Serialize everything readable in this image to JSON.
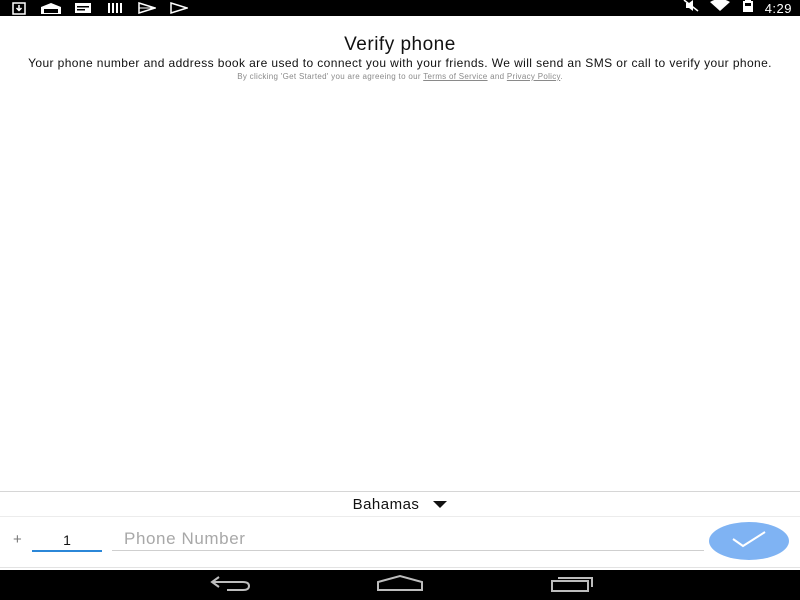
{
  "status_bar": {
    "left_icons": [
      "download-icon",
      "photo-icon",
      "message-icon",
      "barcode-icon",
      "play-store-icon",
      "play-store-icon-2"
    ],
    "right_icons": [
      "mute-icon",
      "wifi-icon",
      "battery-icon"
    ],
    "time": "4:29"
  },
  "header": {
    "title": "Verify phone",
    "description": "Your phone number and address book are used to connect you with your friends. We will send an SMS or call to verify your phone.",
    "terms_prefix": "By clicking 'Get Started' you are agreeing to our ",
    "terms_link": "Terms of Service",
    "terms_and": " and ",
    "privacy_link": "Privacy Policy",
    "terms_suffix": "."
  },
  "form": {
    "country": "Bahamas",
    "plus": "+",
    "country_code": "1",
    "phone_placeholder": "Phone Number",
    "phone_value": ""
  },
  "colors": {
    "accent": "#2b87d8",
    "submit_button": "#7fb3f3"
  },
  "nav_bar": {
    "buttons": [
      "back-icon",
      "home-icon",
      "recents-icon"
    ]
  }
}
